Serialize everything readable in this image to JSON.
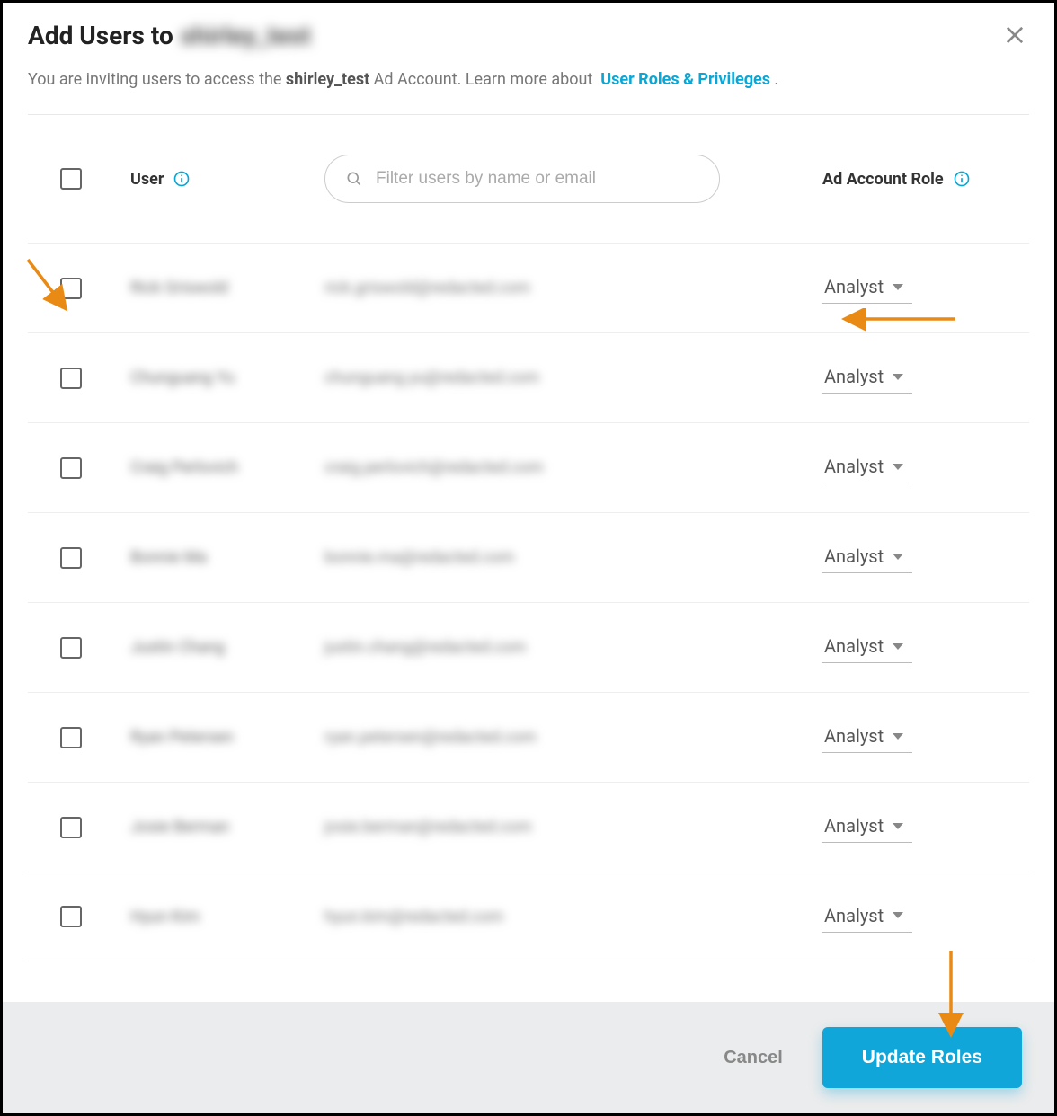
{
  "header": {
    "title_prefix": "Add Users to",
    "title_blurred": "shirley_test"
  },
  "sub": {
    "pre": "You are inviting users to access the ",
    "account_name": "shirley_test",
    "post": " Ad Account. Learn more about ",
    "link": "User Roles & Privileges",
    "trail": " ."
  },
  "table": {
    "user_header": "User",
    "role_header": "Ad Account Role",
    "filter_placeholder": "Filter users by name or email"
  },
  "rows": [
    {
      "name": "Rick Griswold",
      "email": "rick.griswold@redacted.com",
      "role": "Analyst"
    },
    {
      "name": "Chunguang Yu",
      "email": "chunguang.yu@redacted.com",
      "role": "Analyst"
    },
    {
      "name": "Craig Perlovich",
      "email": "craig.perlovich@redacted.com",
      "role": "Analyst"
    },
    {
      "name": "Bonnie Ma",
      "email": "bonnie.ma@redacted.com",
      "role": "Analyst"
    },
    {
      "name": "Justin Chang",
      "email": "justin.chang@redacted.com",
      "role": "Analyst"
    },
    {
      "name": "Ryan Petersen",
      "email": "ryan.petersen@redacted.com",
      "role": "Analyst"
    },
    {
      "name": "Josie Berman",
      "email": "josie.berman@redacted.com",
      "role": "Analyst"
    },
    {
      "name": "Hyun Kim",
      "email": "hyun.kim@redacted.com",
      "role": "Analyst"
    }
  ],
  "footer": {
    "cancel": "Cancel",
    "primary": "Update Roles"
  }
}
